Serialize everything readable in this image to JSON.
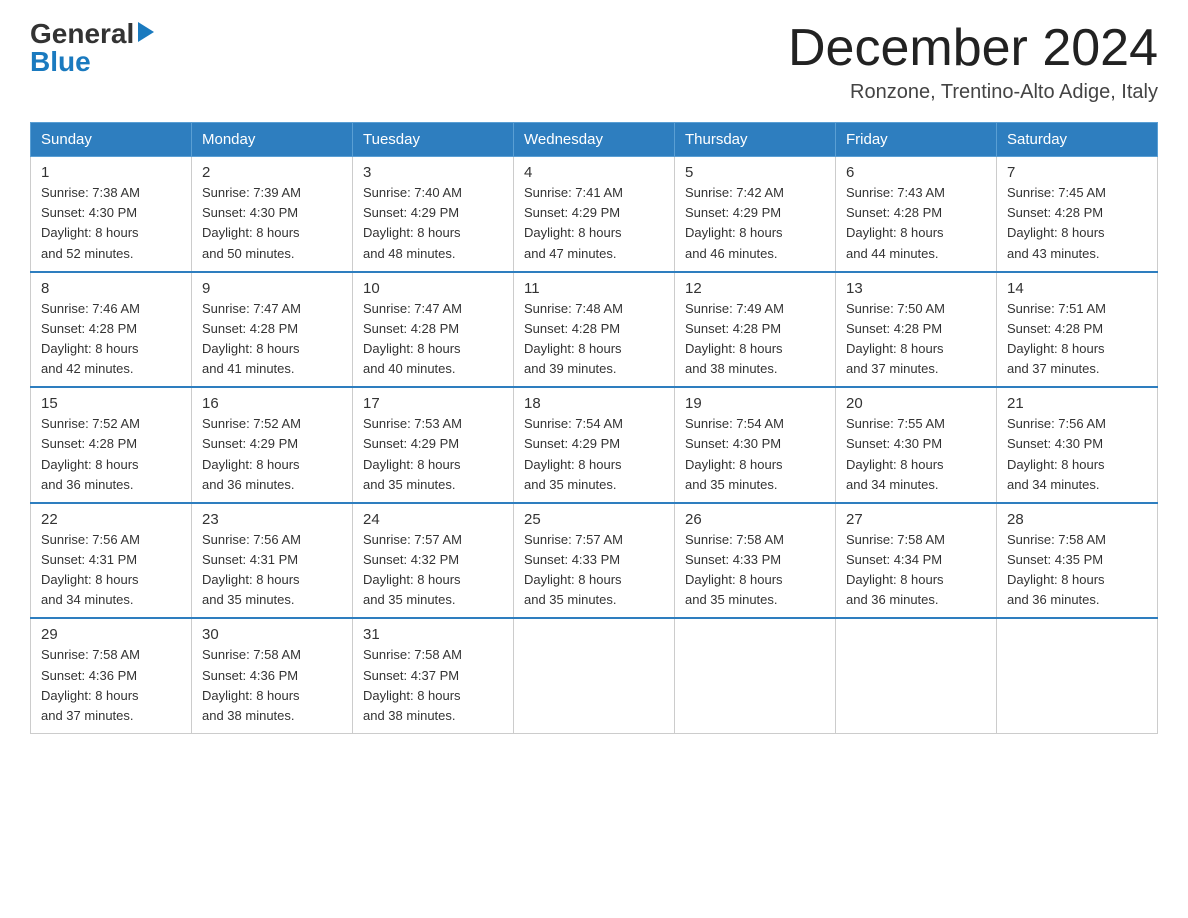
{
  "header": {
    "logo_general": "General",
    "logo_blue": "Blue",
    "month_title": "December 2024",
    "location": "Ronzone, Trentino-Alto Adige, Italy"
  },
  "days_of_week": [
    "Sunday",
    "Monday",
    "Tuesday",
    "Wednesday",
    "Thursday",
    "Friday",
    "Saturday"
  ],
  "weeks": [
    [
      {
        "day": "1",
        "sunrise": "7:38 AM",
        "sunset": "4:30 PM",
        "daylight": "8 hours and 52 minutes."
      },
      {
        "day": "2",
        "sunrise": "7:39 AM",
        "sunset": "4:30 PM",
        "daylight": "8 hours and 50 minutes."
      },
      {
        "day": "3",
        "sunrise": "7:40 AM",
        "sunset": "4:29 PM",
        "daylight": "8 hours and 48 minutes."
      },
      {
        "day": "4",
        "sunrise": "7:41 AM",
        "sunset": "4:29 PM",
        "daylight": "8 hours and 47 minutes."
      },
      {
        "day": "5",
        "sunrise": "7:42 AM",
        "sunset": "4:29 PM",
        "daylight": "8 hours and 46 minutes."
      },
      {
        "day": "6",
        "sunrise": "7:43 AM",
        "sunset": "4:28 PM",
        "daylight": "8 hours and 44 minutes."
      },
      {
        "day": "7",
        "sunrise": "7:45 AM",
        "sunset": "4:28 PM",
        "daylight": "8 hours and 43 minutes."
      }
    ],
    [
      {
        "day": "8",
        "sunrise": "7:46 AM",
        "sunset": "4:28 PM",
        "daylight": "8 hours and 42 minutes."
      },
      {
        "day": "9",
        "sunrise": "7:47 AM",
        "sunset": "4:28 PM",
        "daylight": "8 hours and 41 minutes."
      },
      {
        "day": "10",
        "sunrise": "7:47 AM",
        "sunset": "4:28 PM",
        "daylight": "8 hours and 40 minutes."
      },
      {
        "day": "11",
        "sunrise": "7:48 AM",
        "sunset": "4:28 PM",
        "daylight": "8 hours and 39 minutes."
      },
      {
        "day": "12",
        "sunrise": "7:49 AM",
        "sunset": "4:28 PM",
        "daylight": "8 hours and 38 minutes."
      },
      {
        "day": "13",
        "sunrise": "7:50 AM",
        "sunset": "4:28 PM",
        "daylight": "8 hours and 37 minutes."
      },
      {
        "day": "14",
        "sunrise": "7:51 AM",
        "sunset": "4:28 PM",
        "daylight": "8 hours and 37 minutes."
      }
    ],
    [
      {
        "day": "15",
        "sunrise": "7:52 AM",
        "sunset": "4:28 PM",
        "daylight": "8 hours and 36 minutes."
      },
      {
        "day": "16",
        "sunrise": "7:52 AM",
        "sunset": "4:29 PM",
        "daylight": "8 hours and 36 minutes."
      },
      {
        "day": "17",
        "sunrise": "7:53 AM",
        "sunset": "4:29 PM",
        "daylight": "8 hours and 35 minutes."
      },
      {
        "day": "18",
        "sunrise": "7:54 AM",
        "sunset": "4:29 PM",
        "daylight": "8 hours and 35 minutes."
      },
      {
        "day": "19",
        "sunrise": "7:54 AM",
        "sunset": "4:30 PM",
        "daylight": "8 hours and 35 minutes."
      },
      {
        "day": "20",
        "sunrise": "7:55 AM",
        "sunset": "4:30 PM",
        "daylight": "8 hours and 34 minutes."
      },
      {
        "day": "21",
        "sunrise": "7:56 AM",
        "sunset": "4:30 PM",
        "daylight": "8 hours and 34 minutes."
      }
    ],
    [
      {
        "day": "22",
        "sunrise": "7:56 AM",
        "sunset": "4:31 PM",
        "daylight": "8 hours and 34 minutes."
      },
      {
        "day": "23",
        "sunrise": "7:56 AM",
        "sunset": "4:31 PM",
        "daylight": "8 hours and 35 minutes."
      },
      {
        "day": "24",
        "sunrise": "7:57 AM",
        "sunset": "4:32 PM",
        "daylight": "8 hours and 35 minutes."
      },
      {
        "day": "25",
        "sunrise": "7:57 AM",
        "sunset": "4:33 PM",
        "daylight": "8 hours and 35 minutes."
      },
      {
        "day": "26",
        "sunrise": "7:58 AM",
        "sunset": "4:33 PM",
        "daylight": "8 hours and 35 minutes."
      },
      {
        "day": "27",
        "sunrise": "7:58 AM",
        "sunset": "4:34 PM",
        "daylight": "8 hours and 36 minutes."
      },
      {
        "day": "28",
        "sunrise": "7:58 AM",
        "sunset": "4:35 PM",
        "daylight": "8 hours and 36 minutes."
      }
    ],
    [
      {
        "day": "29",
        "sunrise": "7:58 AM",
        "sunset": "4:36 PM",
        "daylight": "8 hours and 37 minutes."
      },
      {
        "day": "30",
        "sunrise": "7:58 AM",
        "sunset": "4:36 PM",
        "daylight": "8 hours and 38 minutes."
      },
      {
        "day": "31",
        "sunrise": "7:58 AM",
        "sunset": "4:37 PM",
        "daylight": "8 hours and 38 minutes."
      },
      null,
      null,
      null,
      null
    ]
  ],
  "labels": {
    "sunrise": "Sunrise:",
    "sunset": "Sunset:",
    "daylight": "Daylight:"
  }
}
